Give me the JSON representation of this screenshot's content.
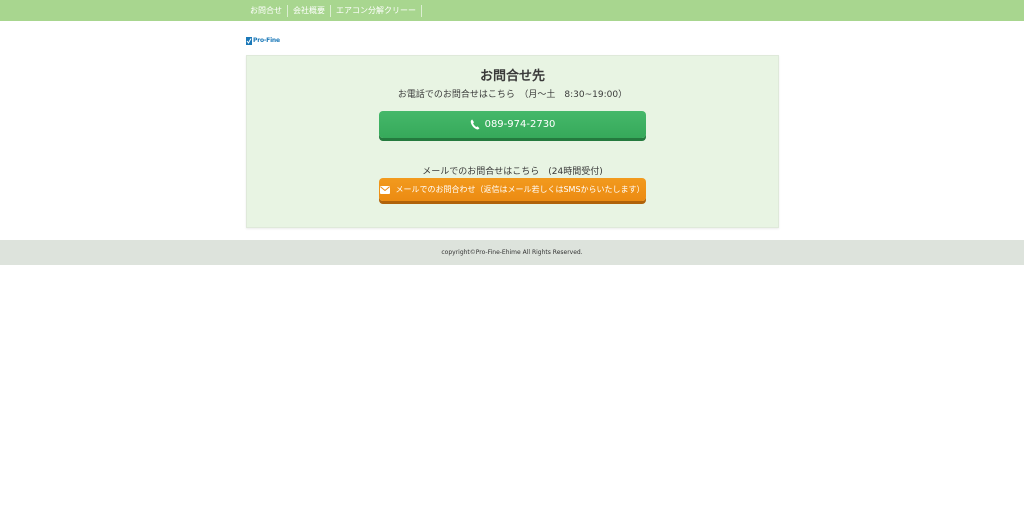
{
  "nav": {
    "items": [
      {
        "label": "お問合せ"
      },
      {
        "label": "会社概要"
      },
      {
        "label": "エアコン分解クリーー"
      }
    ]
  },
  "logo": {
    "text": "Pro-Fine"
  },
  "contact": {
    "title": "お問合せ先",
    "phone_lead": "お電話でのお問合せはこちら　（月〜土　8:30~19:00）",
    "phone_number": "089-974-2730",
    "mail_lead": "メールでのお問合せはこちら　(24時間受付)",
    "mail_button": "メールでのお問合わせ（返信はメール若しくはSMSからいたします）"
  },
  "footer": {
    "copyright": "copyright©Pro-Fine-Ehime All Rights Reserved."
  },
  "colors": {
    "nav_bg": "#a8d68f",
    "box_bg": "#e8f4e3",
    "phone_button": "#3db264",
    "mail_button": "#ef9218",
    "footer_bg": "#dde3dc"
  },
  "icons": {
    "phone": "phone-icon",
    "mail": "mail-icon",
    "logo": "logo-check-icon"
  }
}
